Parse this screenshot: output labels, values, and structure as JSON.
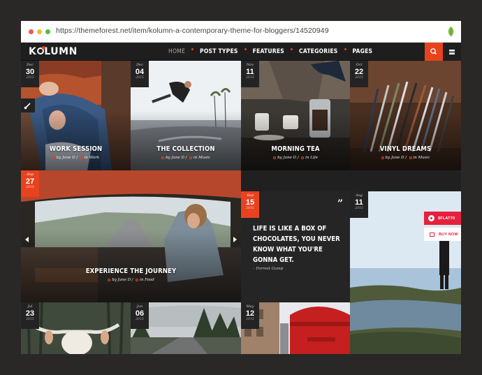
{
  "browser": {
    "url": "https://themeforest.net/item/kolumn-a-contemporary-theme-for-bloggers/14520949",
    "leaf_icon": "envato-leaf-icon"
  },
  "site": {
    "logo_left": "K",
    "logo_right": "LUMN",
    "nav": [
      {
        "label": "HOME",
        "active": true
      },
      {
        "label": "POST TYPES",
        "active": false
      },
      {
        "label": "FEATURES",
        "active": false
      },
      {
        "label": "CATEGORIES",
        "active": false
      },
      {
        "label": "PAGES",
        "active": false
      }
    ],
    "accent": "#e8421f"
  },
  "posts": [
    {
      "month": "Dec",
      "day": "30",
      "year": "2015",
      "title": "WORK SESSION",
      "author": "by Jane D",
      "category": "in Work"
    },
    {
      "month": "Dec",
      "day": "04",
      "year": "2015",
      "title": "THE COLLECTION",
      "author": "by Jane D",
      "category": "in Music"
    },
    {
      "month": "Nov",
      "day": "11",
      "year": "2015",
      "title": "MORNING TEA",
      "author": "by Jane D",
      "category": "in Life"
    },
    {
      "month": "Oct",
      "day": "22",
      "year": "2015",
      "title": "VINYL DREAMS",
      "author": "by Jane D",
      "category": "in Music"
    },
    {
      "month": "Sep",
      "day": "27",
      "year": "2015",
      "title": "EXPERIENCE THE JOURNEY",
      "author": "by Jane D",
      "category": "in Food"
    },
    {
      "month": "Sep",
      "day": "15",
      "year": "2015"
    },
    {
      "month": "Aug",
      "day": "11",
      "year": "2015"
    },
    {
      "month": "Jul",
      "day": "23",
      "year": "2015"
    },
    {
      "month": "Jun",
      "day": "06",
      "year": "2015"
    },
    {
      "month": "May",
      "day": "12",
      "year": "2015"
    }
  ],
  "quote": {
    "text": "LIFE IS LIKE A BOX OF CHOCOLATES, YOU NEVER KNOW WHAT YOU'RE GONNA GET.",
    "author": "– Forrest Gump"
  },
  "side": {
    "red_label": "$FLAT70",
    "white_label": "BUY NOW"
  }
}
